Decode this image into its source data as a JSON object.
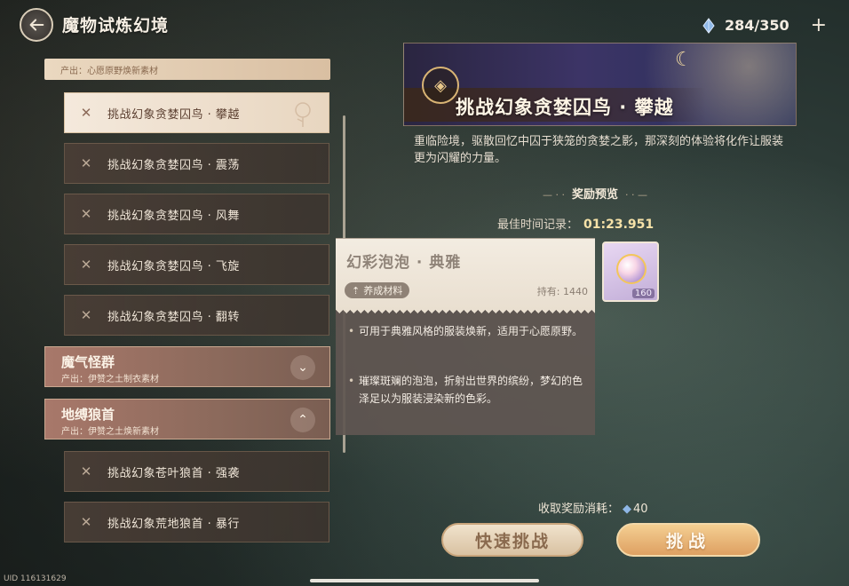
{
  "header": {
    "title": "魔物试炼幻境",
    "stamina": "284/350",
    "plus": "+",
    "stamina_icon": "crystal-icon"
  },
  "list": {
    "top_group_sub": "产出：心愿原野焕新素材",
    "items_a": [
      {
        "label": "挑战幻象贪婪囚鸟 · 攀越",
        "active": true
      },
      {
        "label": "挑战幻象贪婪囚鸟 · 震荡",
        "active": false
      },
      {
        "label": "挑战幻象贪婪囚鸟 · 风舞",
        "active": false
      },
      {
        "label": "挑战幻象贪婪囚鸟 · 飞旋",
        "active": false
      },
      {
        "label": "挑战幻象贪婪囚鸟 · 翻转",
        "active": false
      }
    ],
    "group_b": {
      "name": "魔气怪群",
      "sub": "产出：伊赞之土制衣素材",
      "chevron": "⌄"
    },
    "group_c": {
      "name": "地缚狼首",
      "sub": "产出：伊赞之土焕新素材",
      "chevron": "⌃"
    },
    "items_c": [
      {
        "label": "挑战幻象苍叶狼首 · 强袭"
      },
      {
        "label": "挑战幻象荒地狼首 · 暴行"
      }
    ]
  },
  "detail": {
    "banner_title": "挑战幻象贪婪囚鸟 · 攀越",
    "description": "重临险境，驱散回忆中囚于狭笼的贪婪之影，那深刻的体验将化作让服装更为闪耀的力量。",
    "reward_heading": "奖励预览",
    "best_label": "最佳时间记录：",
    "best_time": "01:23.951",
    "reward_count": "160"
  },
  "tooltip": {
    "name": "幻彩泡泡 · 典雅",
    "tag": "养成材料",
    "owned": "持有: 1440",
    "line1": "可用于典雅风格的服装焕新，适用于心愿原野。",
    "line2": "璀璨斑斓的泡泡，折射出世界的缤纷，梦幻的色泽足以为服装浸染新的色彩。"
  },
  "footer": {
    "cost_label": "收取奖励消耗：",
    "cost_value": "40",
    "quick_button": "快速挑战",
    "go_button": "挑战",
    "uid": "UID 116131629"
  }
}
